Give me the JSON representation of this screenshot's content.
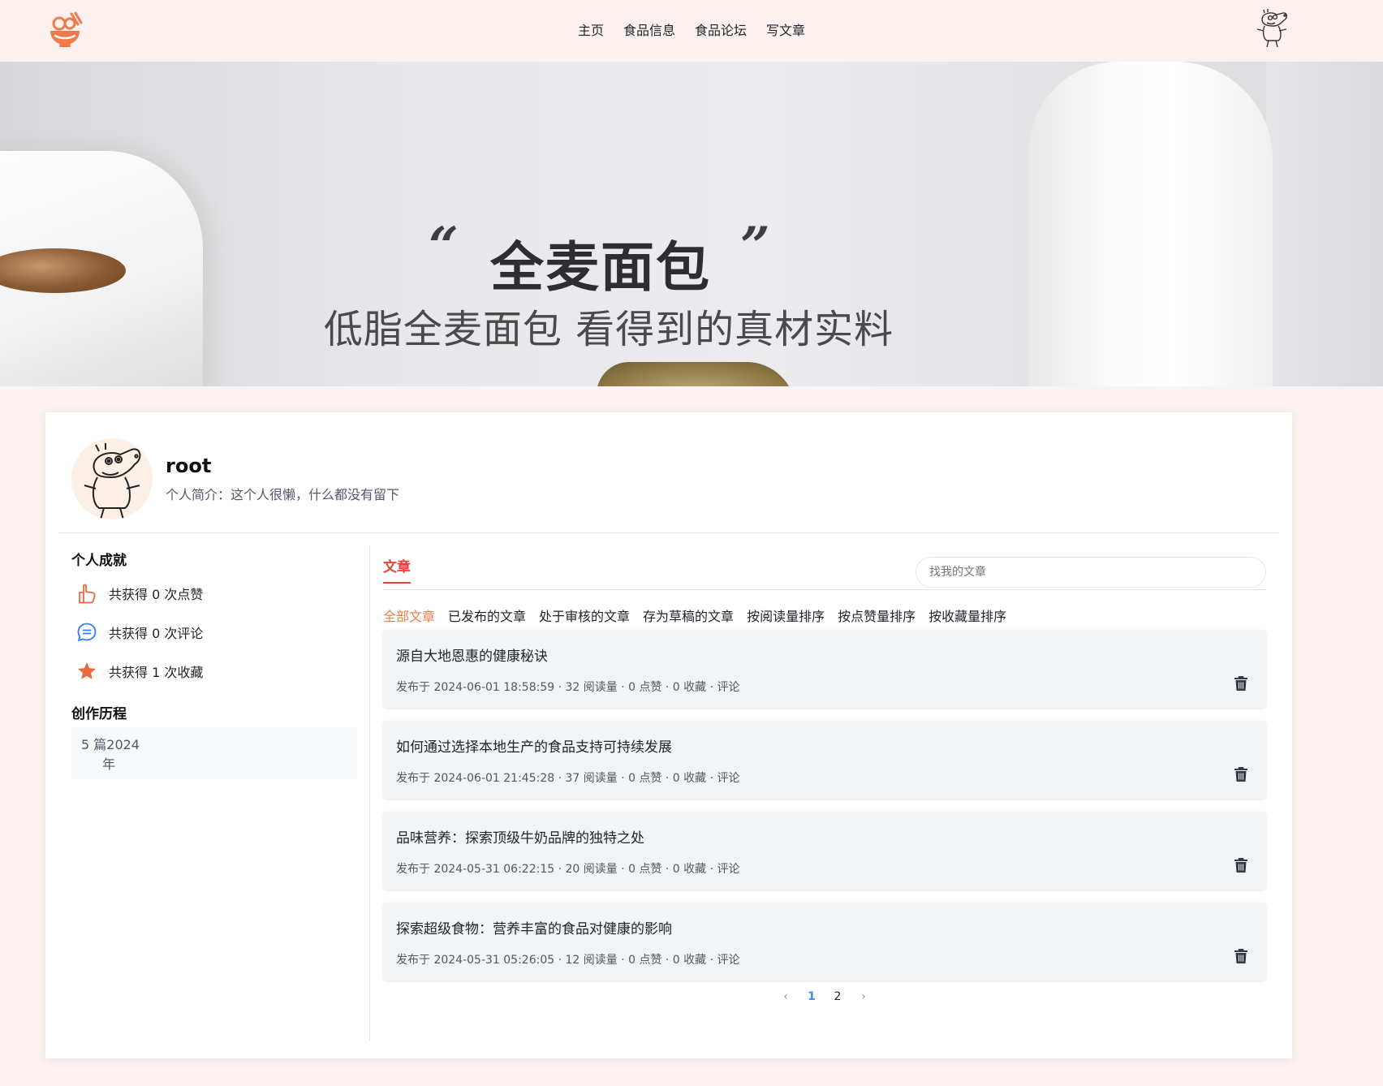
{
  "header": {
    "logo_icon": "food-bowl-logo-icon",
    "nav": [
      "主页",
      "食品信息",
      "食品论坛",
      "写文章"
    ],
    "user_avatar_icon": "peppa-pig-avatar-icon"
  },
  "banner": {
    "quote_open": "“",
    "quote_close": "”",
    "title": "全麦面包",
    "subtitle": "低脂全麦面包 看得到的真材实料",
    "active_slide": 3,
    "slide_count": 3
  },
  "profile": {
    "username": "root",
    "bio": "个人简介：这个人很懒，什么都没有留下"
  },
  "achievements": {
    "title": "个人成就",
    "items": [
      {
        "icon": "thumb-up-icon",
        "text": "共获得 0 次点赞"
      },
      {
        "icon": "comment-icon",
        "text": "共获得 0 次评论"
      },
      {
        "icon": "star-icon",
        "text": "共获得 1 次收藏"
      }
    ]
  },
  "timeline": {
    "title": "创作历程",
    "line1": "5 篇2024",
    "line2": "年"
  },
  "articles_panel": {
    "tab": "文章",
    "search_placeholder": "找我的文章",
    "filters": [
      "全部文章",
      "已发布的文章",
      "处于审核的文章",
      "存为草稿的文章",
      "按阅读量排序",
      "按点赞量排序",
      "按收藏量排序"
    ],
    "active_filter": 0,
    "items": [
      {
        "title": "源自大地恩惠的健康秘诀",
        "meta": "发布于 2024-06-01 18:58:59 · 32 阅读量 · 0 点赞 · 0 收藏 · 评论"
      },
      {
        "title": "如何通过选择本地生产的食品支持可持续发展",
        "meta": "发布于 2024-06-01 21:45:28 · 37 阅读量 · 0 点赞 · 0 收藏 · 评论"
      },
      {
        "title": "品味营养：探索顶级牛奶品牌的独特之处",
        "meta": "发布于 2024-05-31 06:22:15 · 20 阅读量 · 0 点赞 · 0 收藏 · 评论"
      },
      {
        "title": "探索超级食物：营养丰富的食品对健康的影响",
        "meta": "发布于 2024-05-31 05:26:05 · 12 阅读量 · 0 点赞 · 0 收藏 · 评论"
      }
    ],
    "delete_icon": "trash-icon"
  },
  "pagination": {
    "prev": "‹",
    "pages": [
      "1",
      "2"
    ],
    "current": "1",
    "next": "›"
  },
  "colors": {
    "accent": "#e5443a",
    "filter_active": "#f07a4a",
    "page_active": "#3c8ef3",
    "header_bg": "#fcf1ef"
  }
}
